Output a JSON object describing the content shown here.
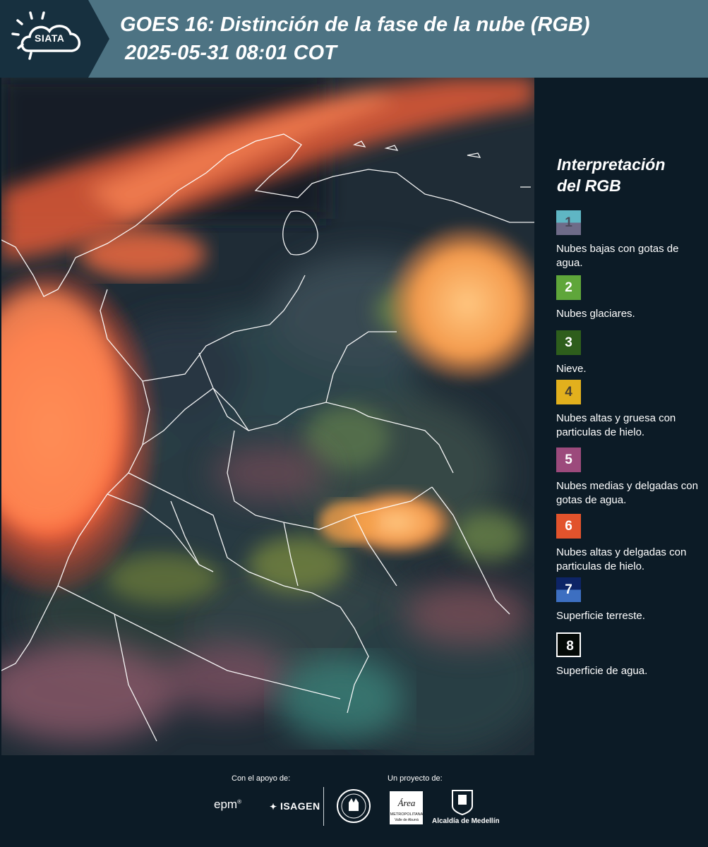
{
  "header": {
    "logo_text": "SIATA",
    "title": "GOES 16: Distinción de la fase de la nube (RGB)",
    "subtitle": "2025-05-31 08:01 COT"
  },
  "legend": {
    "title_line1": "Interpretación",
    "title_line2": "del RGB",
    "items": [
      {
        "number": "1",
        "label": "Nubes bajas con gotas de agua.",
        "color_top": "#5fb6c4",
        "color_bottom": "#6e6b88",
        "text_color": "#4a4a5a"
      },
      {
        "number": "2",
        "label": "Nubes glaciares.",
        "color_top": "#5fa63a",
        "color_bottom": "#5fa63a",
        "text_color": "#ffffff"
      },
      {
        "number": "3",
        "label": "Nieve.",
        "color_top": "#2e5e1c",
        "color_bottom": "#2e5e1c",
        "text_color": "#ffffff"
      },
      {
        "number": "4",
        "label": "Nubes altas y gruesa con particulas de hielo.",
        "color_top": "#e2b01d",
        "color_bottom": "#e2b01d",
        "text_color": "#4a4030"
      },
      {
        "number": "5",
        "label": "Nubes medias y delgadas con gotas de agua.",
        "color_top": "#9c4a7c",
        "color_bottom": "#9c4a7c",
        "text_color": "#ffffff"
      },
      {
        "number": "6",
        "label": "Nubes altas y delgadas con particulas de hielo.",
        "color_top": "#e2532c",
        "color_bottom": "#e2532c",
        "text_color": "#ffffff"
      },
      {
        "number": "7",
        "label": "Superficie terreste.",
        "color_top": "#0d2466",
        "color_bottom": "#3d6fc1",
        "text_color": "#ffffff"
      },
      {
        "number": "8",
        "label": "Superficie de agua.",
        "color_top": "#050a07",
        "color_bottom": "#050a07",
        "text_color": "#ffffff",
        "border": "#ffffff"
      }
    ]
  },
  "footer": {
    "support_label": "Con el apoyo de:",
    "project_label": "Un proyecto de:",
    "epm_text": "epm",
    "isagen_text": "ISAGEN",
    "area_text_main": "Área",
    "area_text_sub": "METROPOLITANA",
    "area_text_sub2": "Valle de Aburrá",
    "alcaldia_text": "Alcaldía de Medellín"
  }
}
